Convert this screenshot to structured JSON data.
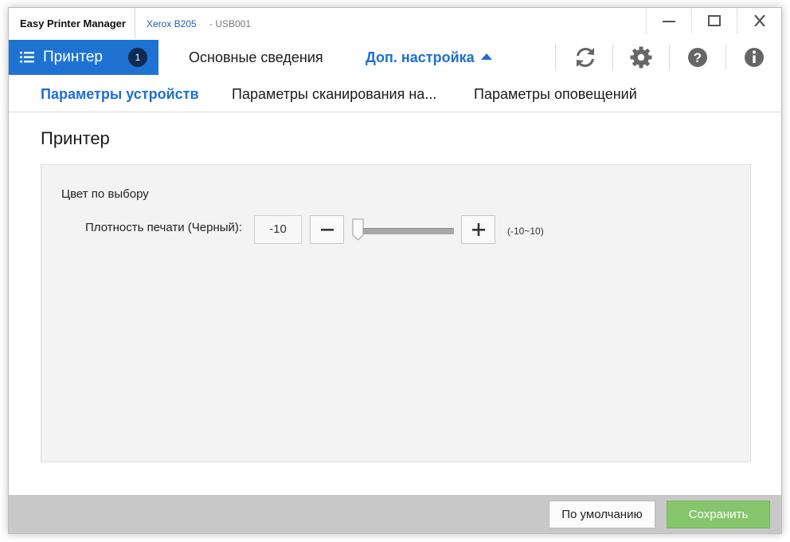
{
  "window": {
    "app_title": "Easy Printer Manager",
    "device_name": "Xerox B205",
    "device_port": "- USB001"
  },
  "nav": {
    "printer_label": "Принтер",
    "printer_badge": "1",
    "basic_info": "Основные сведения",
    "advanced": "Доп. настройка"
  },
  "toolbar_icons": [
    "refresh-icon",
    "gear-icon",
    "help-icon",
    "info-icon"
  ],
  "subtabs": {
    "device_params": "Параметры устройств",
    "scan_params": "Параметры сканирования на...",
    "alert_params": "Параметры оповещений"
  },
  "content": {
    "section_title": "Принтер",
    "group_label": "Цвет по выбору",
    "density_label": "Плотность печати (Черный):",
    "density_value": "-10",
    "range_text": "(-10~10)",
    "slider": {
      "min": -10,
      "max": 10,
      "value": -10
    }
  },
  "footer": {
    "default_label": "По умолчанию",
    "save_label": "Сохранить"
  },
  "colors": {
    "accent": "#1e73d2",
    "save": "#85c66c",
    "badge": "#0d2a52"
  }
}
